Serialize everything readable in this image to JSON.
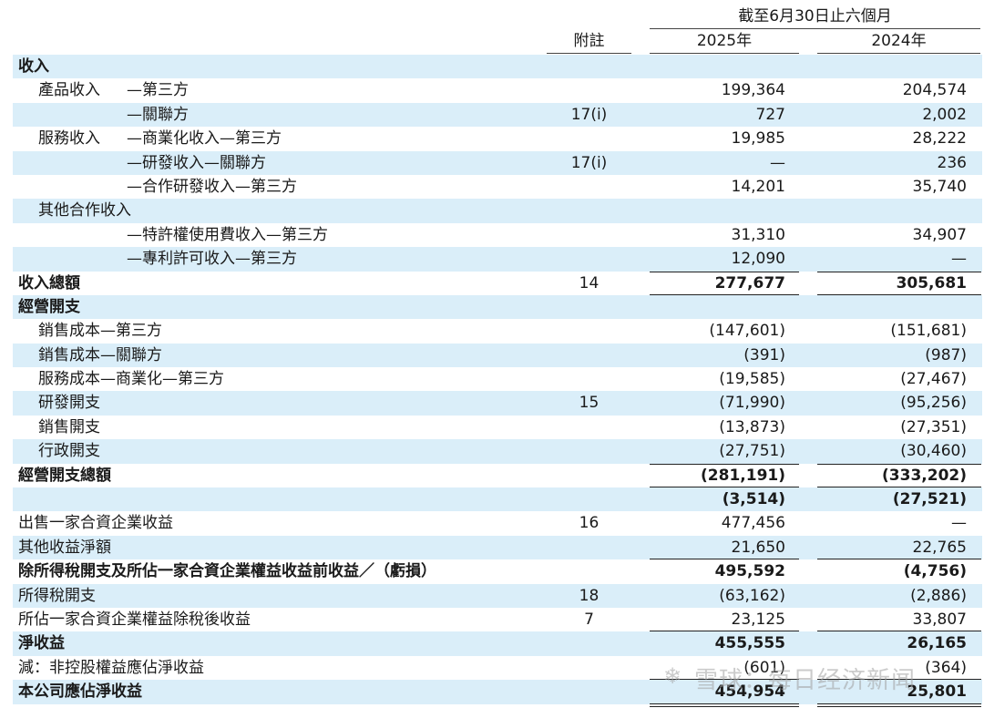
{
  "header": {
    "period": "截至6月30日止六個月",
    "note": "附註",
    "year1": "2025年",
    "year2": "2024年"
  },
  "rows": [
    {
      "label": "收入",
      "note": "",
      "v1": "",
      "v2": ""
    },
    {
      "prefix": "產品收入",
      "label": "—第三方",
      "note": "",
      "v1": "199,364",
      "v2": "204,574"
    },
    {
      "label": "—關聯方",
      "note": "17(i)",
      "v1": "727",
      "v2": "2,002"
    },
    {
      "prefix": "服務收入",
      "label": "—商業化收入—第三方",
      "note": "",
      "v1": "19,985",
      "v2": "28,222"
    },
    {
      "label": "—研發收入—關聯方",
      "note": "17(i)",
      "v1": "—",
      "v2": "236"
    },
    {
      "label": "—合作研發收入—第三方",
      "note": "",
      "v1": "14,201",
      "v2": "35,740"
    },
    {
      "label": "其他合作收入",
      "note": "",
      "v1": "",
      "v2": ""
    },
    {
      "label": "—特許權使用費收入—第三方",
      "note": "",
      "v1": "31,310",
      "v2": "34,907"
    },
    {
      "label": "—專利許可收入—第三方",
      "note": "",
      "v1": "12,090",
      "v2": "—"
    },
    {
      "label": "收入總額",
      "note": "14",
      "v1": "277,677",
      "v2": "305,681"
    },
    {
      "label": "經營開支",
      "note": "",
      "v1": "",
      "v2": ""
    },
    {
      "label": "銷售成本—第三方",
      "note": "",
      "v1": "(147,601)",
      "v2": "(151,681)"
    },
    {
      "label": "銷售成本—關聯方",
      "note": "",
      "v1": "(391)",
      "v2": "(987)"
    },
    {
      "label": "服務成本—商業化—第三方",
      "note": "",
      "v1": "(19,585)",
      "v2": "(27,467)"
    },
    {
      "label": "研發開支",
      "note": "15",
      "v1": "(71,990)",
      "v2": "(95,256)"
    },
    {
      "label": "銷售開支",
      "note": "",
      "v1": "(13,873)",
      "v2": "(27,351)"
    },
    {
      "label": "行政開支",
      "note": "",
      "v1": "(27,751)",
      "v2": "(30,460)"
    },
    {
      "label": "經營開支總額",
      "note": "",
      "v1": "(281,191)",
      "v2": "(333,202)"
    },
    {
      "label": "",
      "note": "",
      "v1": "(3,514)",
      "v2": "(27,521)"
    },
    {
      "label": "出售一家合資企業收益",
      "note": "16",
      "v1": "477,456",
      "v2": "—"
    },
    {
      "label": "其他收益淨額",
      "note": "",
      "v1": "21,650",
      "v2": "22,765"
    },
    {
      "label": "除所得稅開支及所佔一家合資企業權益收益前收益／（虧損）",
      "note": "",
      "v1": "495,592",
      "v2": "(4,756)"
    },
    {
      "label": "所得稅開支",
      "note": "18",
      "v1": "(63,162)",
      "v2": "(2,886)"
    },
    {
      "label": "所佔一家合資企業權益除稅後收益",
      "note": "7",
      "v1": "23,125",
      "v2": "33,807"
    },
    {
      "label": "淨收益",
      "note": "",
      "v1": "455,555",
      "v2": "26,165"
    },
    {
      "label": "減：非控股權益應佔淨收益",
      "note": "",
      "v1": "(601)",
      "v2": "(364)"
    },
    {
      "label": "本公司應佔淨收益",
      "note": "",
      "v1": "454,954",
      "v2": "25,801"
    }
  ],
  "watermark": "雪球：每日经济新闻",
  "colors": {
    "row_shade": "#daeef9",
    "text": "#1a1a1a"
  }
}
